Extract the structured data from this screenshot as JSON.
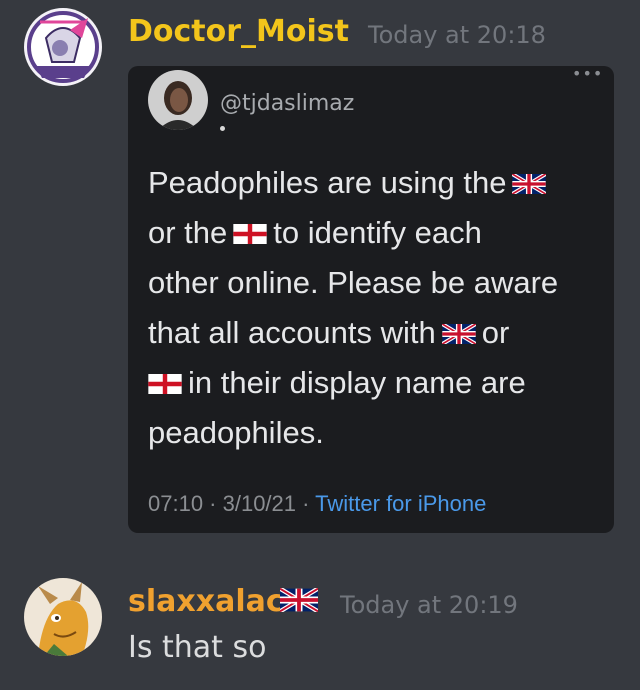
{
  "messages": [
    {
      "username": "Doctor_Moist",
      "username_color": "#f3c51b",
      "timestamp": "Today at 20:18",
      "avatar_icon": "emblem-avatar-icon",
      "embed": {
        "handle": "@tjdaslimaz",
        "text_lines": [
          {
            "before": "Peadophiles are using the",
            "flag": "uk-flag-icon",
            "after": ""
          },
          {
            "before": "or the",
            "flag": "england-flag-icon",
            "after": "to identify each"
          },
          {
            "before": "other online. Please be aware",
            "flag": null,
            "after": ""
          },
          {
            "before": "that all accounts with",
            "flag": "uk-flag-icon",
            "after": "or"
          },
          {
            "before": "",
            "flag": "england-flag-icon",
            "after": "in their display name are"
          },
          {
            "before": "peadophiles.",
            "flag": null,
            "after": ""
          }
        ],
        "meta": "07:10 · 3/10/21 · ",
        "client": "Twitter for iPhone"
      }
    },
    {
      "username": "slaxxalac",
      "username_color": "#f0a12f",
      "name_flag_icon": "uk-flag-icon",
      "timestamp": "Today at 20:19",
      "avatar_icon": "dragon-avatar-icon",
      "content": "Is that so"
    }
  ]
}
